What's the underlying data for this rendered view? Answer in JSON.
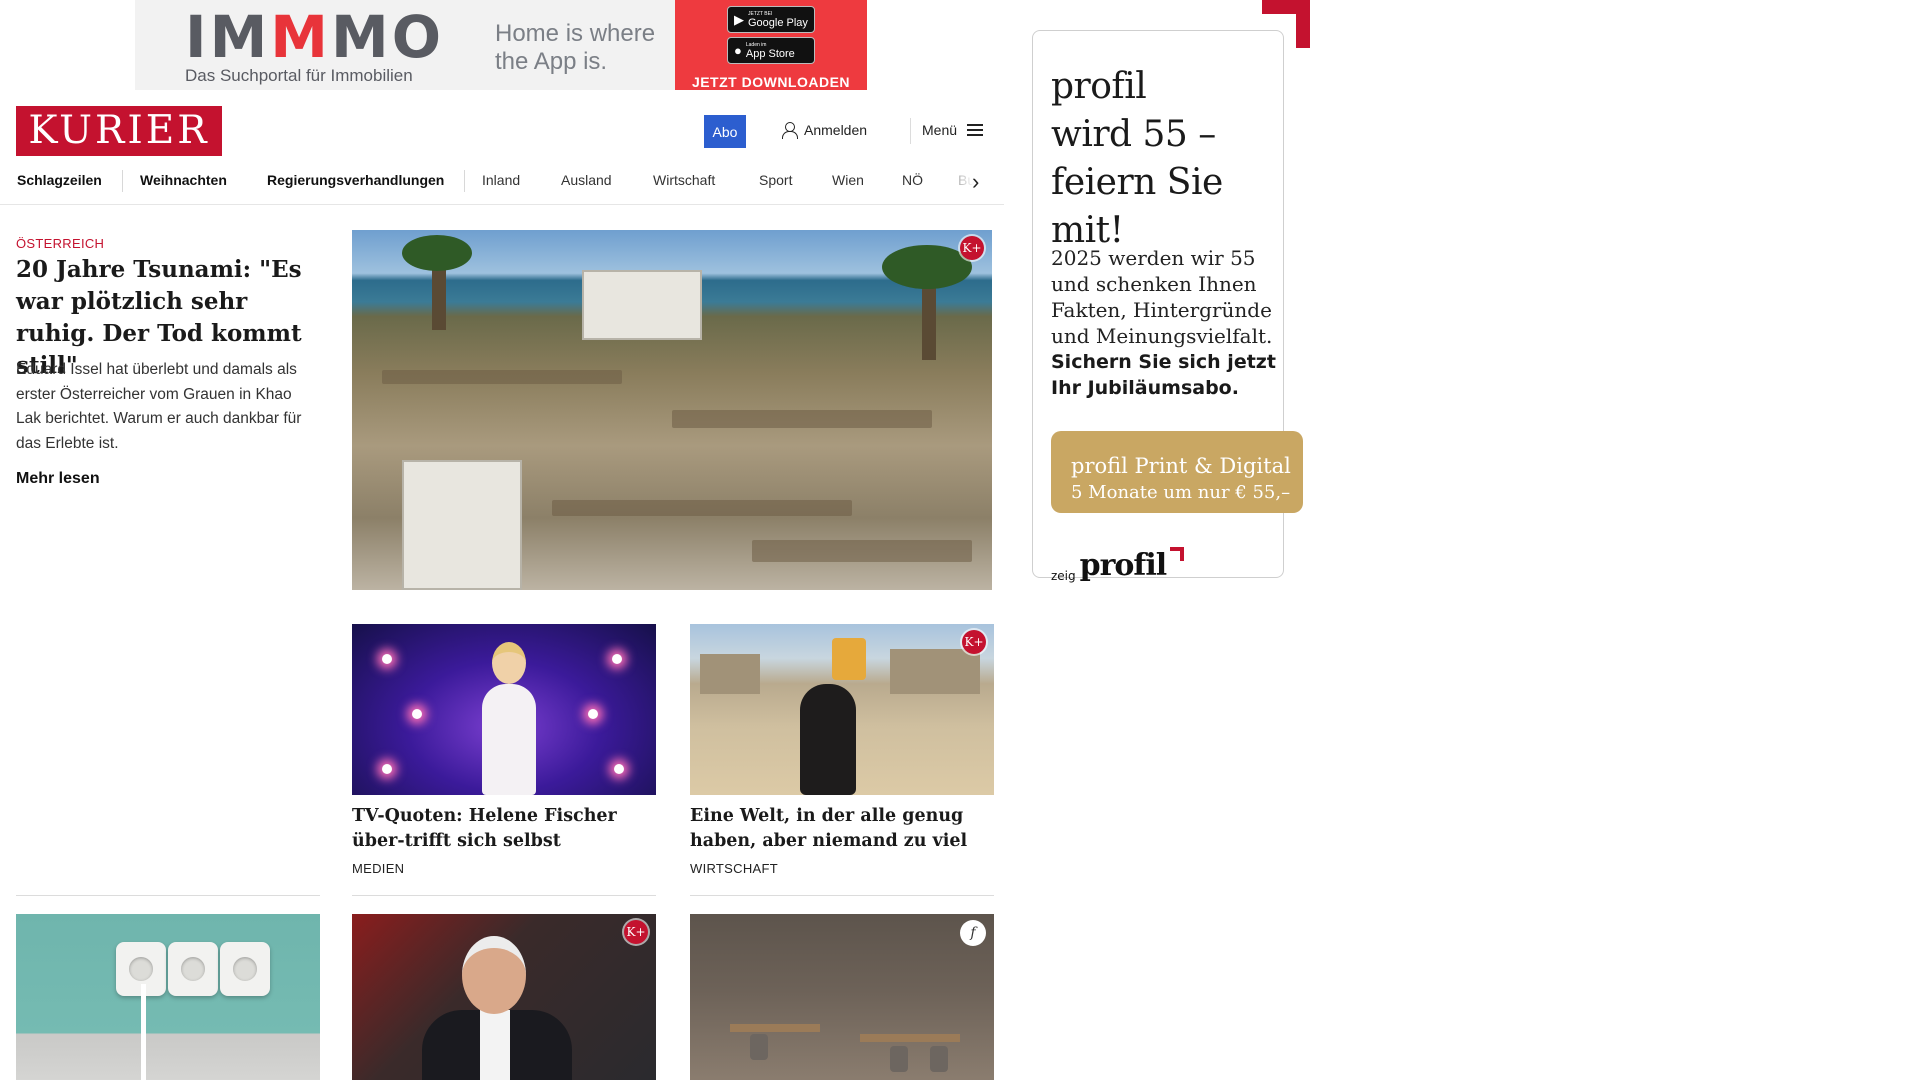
{
  "top_ad": {
    "logo_gray1": "IM",
    "logo_red": "M",
    "logo_gray2": "MO",
    "subtitle": "Das Suchportal für Immobilien",
    "tagline_1": "Home is where",
    "tagline_2": "the App is.",
    "google_small": "JETZT BEI",
    "google_big": "Google Play",
    "apple_small": "Laden im",
    "apple_big": "App Store",
    "cta": "JETZT DOWNLOADEN"
  },
  "header": {
    "logo": "KURIER",
    "abo": "Abo",
    "login": "Anmelden",
    "menu": "Menü"
  },
  "nav": {
    "items": [
      "Schlagzeilen",
      "Weihnachten",
      "Regierungsverhandlungen",
      "Inland",
      "Ausland",
      "Wirtschaft",
      "Sport",
      "Wien",
      "NÖ",
      "Bu"
    ]
  },
  "lead": {
    "kicker": "ÖSTERREICH",
    "title": "20 Jahre Tsunami: \"Es war plötzlich sehr ruhig. Der Tod kommt still\"",
    "teaser": "Eduard Issel hat überlebt und damals als erster Österreicher vom Grauen in Khao Lak berichtet. Warum er auch dankbar für das Erlebte ist.",
    "more": "Mehr lesen",
    "badge": "K+"
  },
  "cards": [
    {
      "title": "TV-Quoten: Helene Fischer über-trifft sich selbst",
      "category": "MEDIEN"
    },
    {
      "title": "Eine Welt, in der alle genug haben, aber niemand zu viel",
      "category": "WIRTSCHAFT",
      "badge": "K+"
    }
  ],
  "bottom_badges": {
    "man": "K+",
    "restaurant": "f"
  },
  "right_ad": {
    "head_1": "profil",
    "head_2": "wird 55 –",
    "head_3": "feiern Sie mit!",
    "body": "2025 werden wir 55 und schenken Ihnen Fakten, Hintergründe und Meinungsvielfalt.",
    "strong": "Sichern Sie sich jetzt Ihr Jubiläumsabo.",
    "button_1": "profil Print & Digital",
    "button_2": "5 Monate um nur € 55,–",
    "foot_small": "zeig",
    "foot_brand": "profil"
  },
  "colors": {
    "kurier_red": "#c4122f",
    "abo_blue": "#2c5ecf",
    "profil_gold": "#c9a763",
    "immmo_red": "#ee3a3f"
  }
}
